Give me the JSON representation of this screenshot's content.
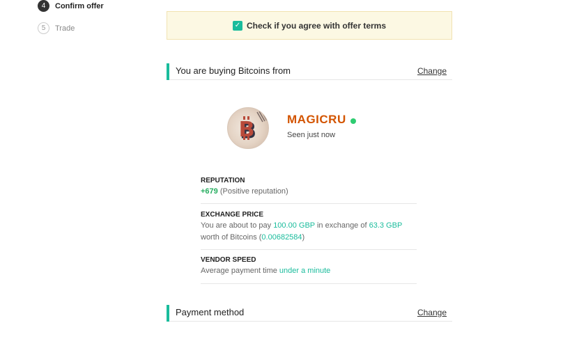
{
  "steps": [
    {
      "num": "4",
      "label": "Confirm offer"
    },
    {
      "num": "5",
      "label": "Trade"
    }
  ],
  "agree": {
    "label": "Check if you agree with offer terms",
    "checked": true
  },
  "vendor_section": {
    "title": "You are buying Bitcoins from",
    "change": "Change"
  },
  "vendor": {
    "name": "MAGICRU",
    "status": "Seen just now",
    "online_color": "#2ecc71"
  },
  "reputation": {
    "label": "REPUTATION",
    "score": "+679",
    "desc": "(Positive reputation)"
  },
  "exchange": {
    "label": "EXCHANGE PRICE",
    "t1": "You are about to pay ",
    "pay": "100.00 GBP",
    "t2": " in exchange of ",
    "receive": "63.3 GBP",
    "t3": "worth of Bitcoins (",
    "btc": "0.00682584",
    "t4": ")"
  },
  "speed": {
    "label": "VENDOR SPEED",
    "t1": "Average payment time ",
    "value": "under a minute"
  },
  "payment_section": {
    "title": "Payment method",
    "change": "Change"
  },
  "colors": {
    "accent": "#1abc9c",
    "vendor": "#d35400",
    "notice_bg": "#fcf8e3"
  }
}
